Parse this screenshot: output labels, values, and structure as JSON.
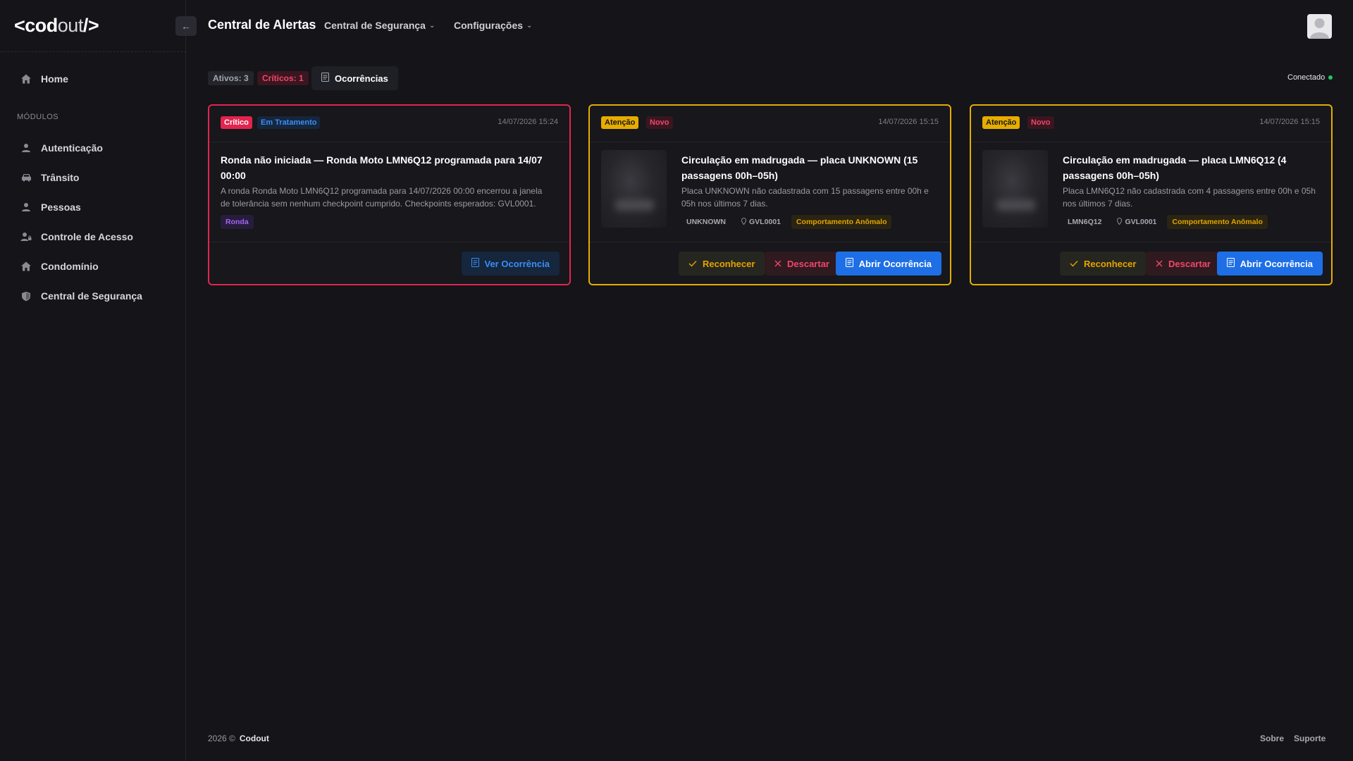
{
  "app": {
    "logo_left": "<cod",
    "logo_mid": "out",
    "logo_right": "/>"
  },
  "sidebar": {
    "home": "Home",
    "section_title": "MÓDULOS",
    "items": [
      {
        "label": "Autenticação",
        "icon": "user-icon"
      },
      {
        "label": "Trânsito",
        "icon": "car-icon"
      },
      {
        "label": "Pessoas",
        "icon": "user-icon"
      },
      {
        "label": "Controle de Acesso",
        "icon": "user-lock-icon"
      },
      {
        "label": "Condomínio",
        "icon": "home-icon"
      },
      {
        "label": "Central de Segurança",
        "icon": "shield-icon"
      }
    ]
  },
  "header": {
    "title": "Central de Alertas",
    "menu_security": "Central de Segurança",
    "menu_settings": "Configurações"
  },
  "toolbar": {
    "active": "Ativos: 3",
    "critical": "Críticos: 1",
    "occurrences": "Ocorrências",
    "status": "Conectado"
  },
  "alerts": [
    {
      "severity": "Crítico",
      "state": "Em Tratamento",
      "time": "14/07/2026 15:24",
      "title_l1": "Ronda não iniciada — Ronda Moto LMN6Q12 programada para 14/07",
      "title_l2": "00:00",
      "desc_l1": "A ronda Ronda Moto LMN6Q12 programada para 14/07/2026 00:00 encerrou a janela",
      "desc_l2": "de tolerância sem nenhum checkpoint cumprido. Checkpoints esperados: GVL0001.",
      "tag": "Ronda",
      "action": "Ver Ocorrência"
    },
    {
      "severity": "Atenção",
      "state": "Novo",
      "time": "14/07/2026 15:15",
      "title_l1": "Circulação em madrugada — placa UNKNOWN (15",
      "title_l2": "passagens 00h–05h)",
      "desc_l1": "Placa UNKNOWN não cadastrada com 15 passagens entre 00h e",
      "desc_l2": "05h nos últimos 7 dias.",
      "plate": "UNKNOWN",
      "location": "GVL0001",
      "category": "Comportamento Anômalo",
      "ack": "Reconhecer",
      "discard": "Descartar",
      "open": "Abrir Ocorrência"
    },
    {
      "severity": "Atenção",
      "state": "Novo",
      "time": "14/07/2026 15:15",
      "title_l1": "Circulação em madrugada — placa LMN6Q12 (4",
      "title_l2": "passagens 00h–05h)",
      "desc_l1": "Placa LMN6Q12 não cadastrada com 4 passagens entre 00h e 05h",
      "desc_l2": "nos últimos 7 dias.",
      "plate": "LMN6Q12",
      "location": "GVL0001",
      "category": "Comportamento Anômalo",
      "ack": "Reconhecer",
      "discard": "Descartar",
      "open": "Abrir Ocorrência"
    }
  ],
  "footer": {
    "year": "2026 ©",
    "brand": "Codout",
    "about": "Sobre",
    "support": "Suporte"
  },
  "colors": {
    "critical": "#e3244e",
    "warning": "#e6ac00",
    "primary": "#1e6fe6",
    "connected": "#22c55e"
  }
}
